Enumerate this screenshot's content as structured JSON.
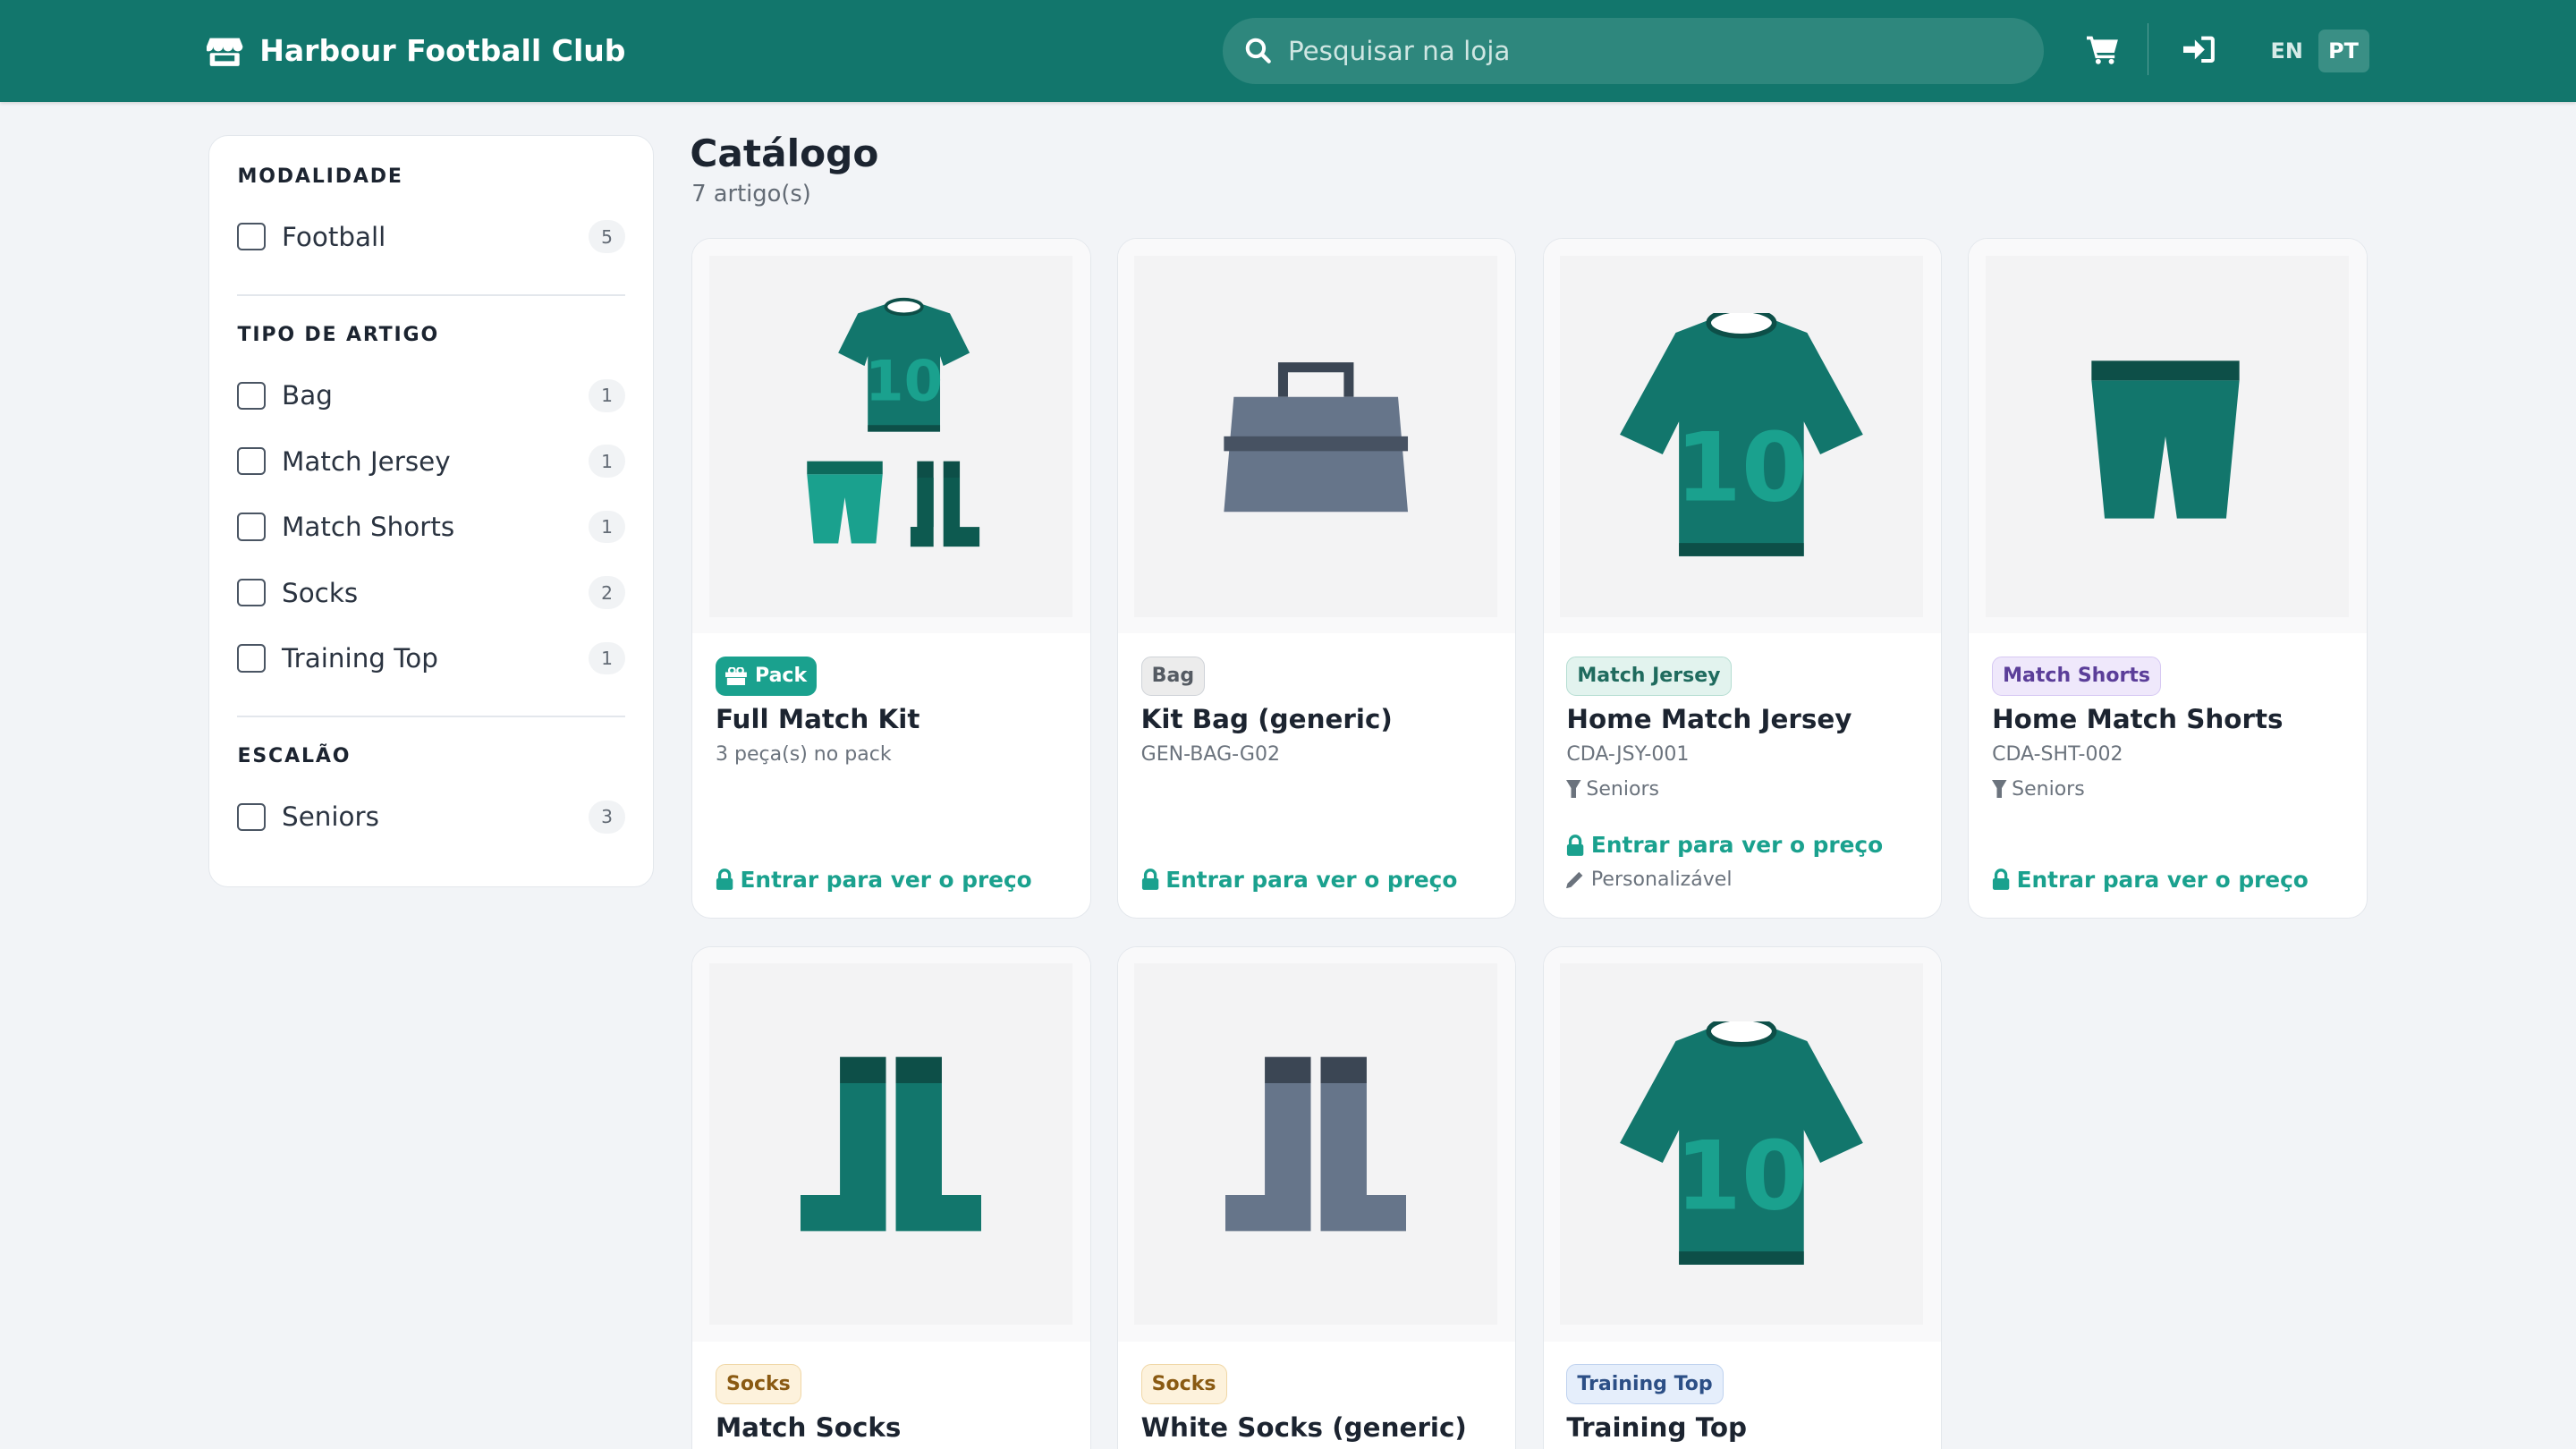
{
  "header": {
    "brand": "Harbour Football Club",
    "search_placeholder": "Pesquisar na loja",
    "lang_en": "EN",
    "lang_pt": "PT",
    "colors": {
      "bar": "#12766c",
      "accent": "#1aa18e"
    }
  },
  "sidebar": {
    "groups": [
      {
        "title": "MODALIDADE",
        "items": [
          {
            "label": "Football",
            "count": "5"
          }
        ]
      },
      {
        "title": "TIPO DE ARTIGO",
        "items": [
          {
            "label": "Bag",
            "count": "1"
          },
          {
            "label": "Match Jersey",
            "count": "1"
          },
          {
            "label": "Match Shorts",
            "count": "1"
          },
          {
            "label": "Socks",
            "count": "2"
          },
          {
            "label": "Training Top",
            "count": "1"
          }
        ]
      },
      {
        "title": "ESCALÃO",
        "items": [
          {
            "label": "Seniors",
            "count": "3"
          }
        ]
      }
    ]
  },
  "catalog": {
    "title": "Catálogo",
    "count": "7 artigo(s)",
    "price_label": "Entrar para ver o preço",
    "cards": [
      {
        "badge": "Pack",
        "title": "Full Match Kit",
        "subtitle": "3 peça(s) no pack",
        "image": "kit-icon"
      },
      {
        "badge": "Bag",
        "title": "Kit Bag (generic)",
        "subtitle": "GEN-BAG-G02",
        "image": "bag-icon"
      },
      {
        "badge": "Match Jersey",
        "title": "Home Match Jersey",
        "subtitle": "CDA-JSY-001",
        "meta": "Seniors",
        "extra": "Personalizável",
        "image": "jersey-icon"
      },
      {
        "badge": "Match Shorts",
        "title": "Home Match Shorts",
        "subtitle": "CDA-SHT-002",
        "meta": "Seniors",
        "image": "shorts-icon"
      },
      {
        "badge": "Socks",
        "title": "Match Socks",
        "image": "socks-icon"
      },
      {
        "badge": "Socks",
        "title": "White Socks (generic)",
        "image": "socks-icon"
      },
      {
        "badge": "Training Top",
        "title": "Training Top",
        "image": "jersey-icon"
      }
    ]
  }
}
